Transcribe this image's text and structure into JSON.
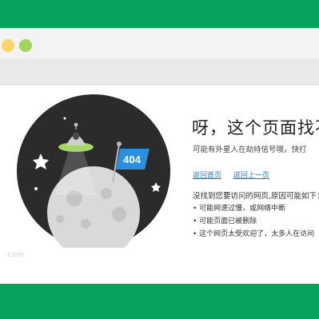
{
  "window": {
    "traffic_lights": [
      "yellow",
      "green"
    ]
  },
  "colors": {
    "brand_green": "#06a35e",
    "planet_bg": "#2b2b2b",
    "moon": "#d9d9d9",
    "flag_blue": "#2a8fe0",
    "link_blue": "#2a78c2"
  },
  "error": {
    "title": "呀，这个页面找不",
    "subtitle": "可能有外星人在劫持信号哦，快打",
    "flag_label": "404",
    "links": [
      "返回首页",
      "返回上一页"
    ],
    "reasons_title": "没找到您要访问的网页,原因可能如下：",
    "reasons": [
      "可能网速过慢，或网络中断",
      "可能页面已被删除",
      "这个网页太受欢迎了，太多人在访问"
    ]
  },
  "watermark": "·com"
}
